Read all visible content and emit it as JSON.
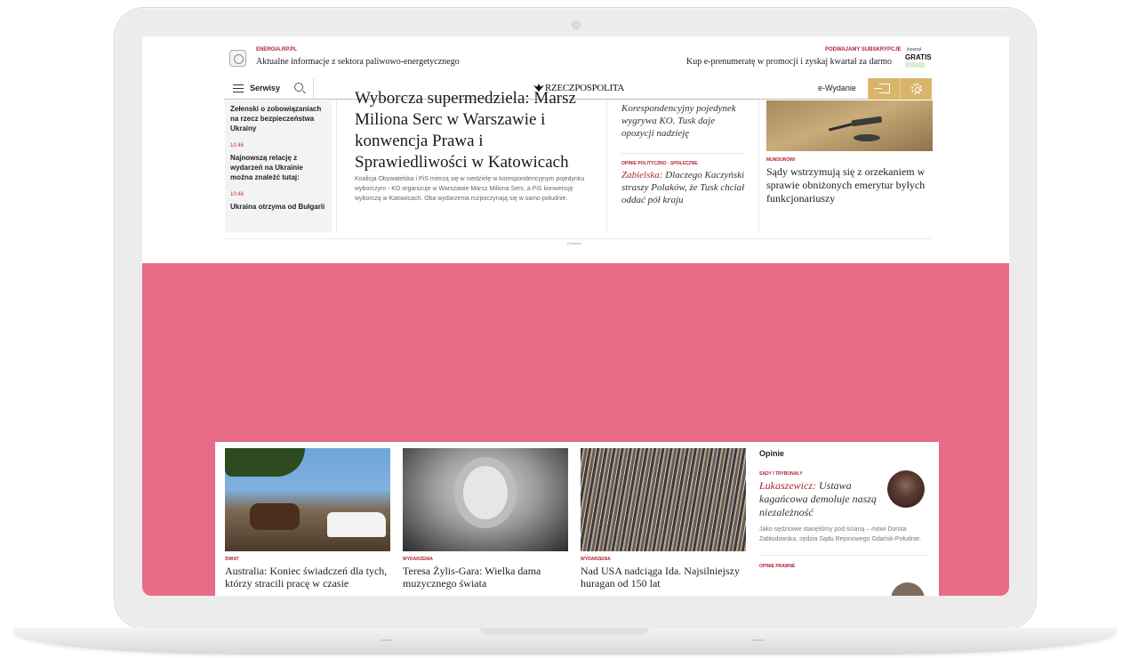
{
  "promo": {
    "left_tag": "ENERGIA.RP.PL",
    "left_text": "Aktualne informacje z sektora paliwowo-energetycznego",
    "right_tag": "PODWAJAMY SUBSKRYPCJE",
    "right_text": "Kup e-prenumeratę w promocji i zyskaj kwartał za darmo",
    "badge_small": "kwartał",
    "badge": "GRATIS"
  },
  "nav": {
    "menu_label": "Serwisy",
    "logo": "RZECZPOSPOLITA",
    "edition": "e-Wydanie"
  },
  "live": [
    {
      "time": "",
      "text": "Zełenski o zobowiązaniach na rzecz bezpieczeństwa Ukrainy"
    },
    {
      "time": "10:46",
      "text": "Najnowszą relację z wydarzeń na Ukrainie można znaleźć tutaj:"
    },
    {
      "time": "10:46",
      "text": "Ukraina otrzyma od Bułgarii"
    }
  ],
  "main": {
    "title": "Wyborcza supermedziela: Marsz Miliona Serc w Warszawie i konwencja Prawa i Sprawiedliwości w Katowicach",
    "lead": "Koalicja Obywatelska i PiS mierzą się w niedzielę w korespondencyjnym pojedynku wyborczym - KO organizuje w Warszawie Marsz Miliona Serc, a PiS konwencję wyborczą w Katowicach. Oba wydarzenia rozpoczynają się w samo południe."
  },
  "col3": {
    "top": "Korespondencyjny pojedynek wygrywa KO. Tusk daje opozycji nadzieję",
    "tag": "OPINIE POLITYCZNO - SPOŁECZNE",
    "author": "Zabielska:",
    "title": "Dlaczego Kaczyński straszy Polaków, że Tusk chciał oddać pół kraju"
  },
  "col4": {
    "tag": "MUNDUROWI",
    "title": "Sądy wstrzymują się z orzekaniem w sprawie obniżonych emerytur byłych funkcjonariuszy"
  },
  "ad_label": "Reklama",
  "cards": [
    {
      "tag": "ŚWIAT",
      "title": "Australia: Koniec świadczeń dla tych, którzy stracili pracę w czasie"
    },
    {
      "tag": "WYDARZENIA",
      "title": "Teresa Żylis-Gara: Wielka dama muzycznego świata"
    },
    {
      "tag": "WYDARZENIA",
      "title": "Nad USA nadciąga Ida. Najsilniejszy huragan od 150 lat"
    }
  ],
  "opinie": {
    "heading": "Opinie",
    "tag": "SĄDY I TRYBUNAŁY",
    "author": "Łukaszewicz:",
    "title": "Ustawa kagańcowa demoluje naszą niezależność",
    "lead": "Jako sędziowie stanęliśmy pod ścianą – mówi Dorota Zabłudowska, sędzia Sądu Rejonowego Gdańsk-Południe.",
    "tag2": "OPINIE PRAWNE"
  },
  "colors": {
    "accent": "#b02335",
    "pink_bg": "#e96b86",
    "gold": "#d9b56a"
  }
}
